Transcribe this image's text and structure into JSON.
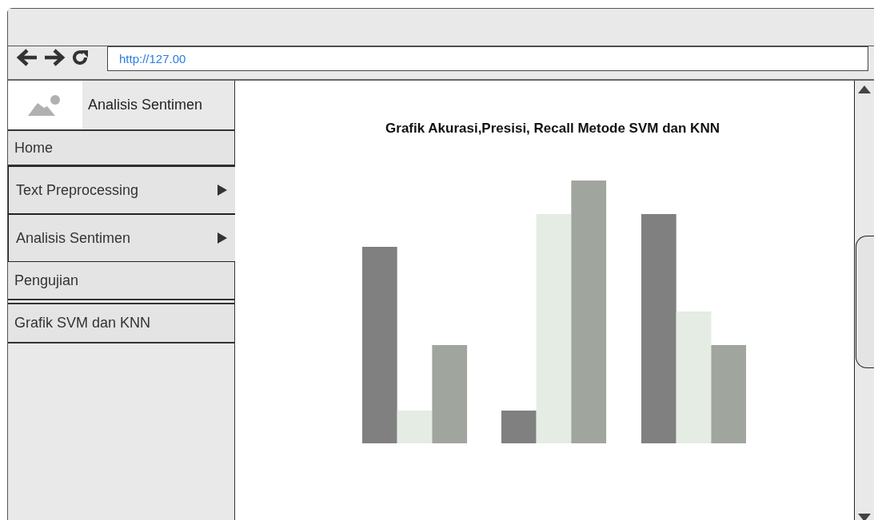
{
  "browser": {
    "url": "http://127.00"
  },
  "sidebar": {
    "title": "Analisis Sentimen",
    "items": [
      {
        "label": "Home",
        "kind": "plain"
      },
      {
        "label": "Text Preprocessing",
        "kind": "submenu"
      },
      {
        "label": "Analisis Sentimen",
        "kind": "submenu"
      },
      {
        "label": "Pengujian",
        "kind": "plain"
      },
      {
        "label": "Grafik SVM dan KNN",
        "kind": "plain"
      }
    ]
  },
  "content": {
    "title": "Grafik Akurasi,Presisi, Recall Metode SVM dan KNN"
  }
}
